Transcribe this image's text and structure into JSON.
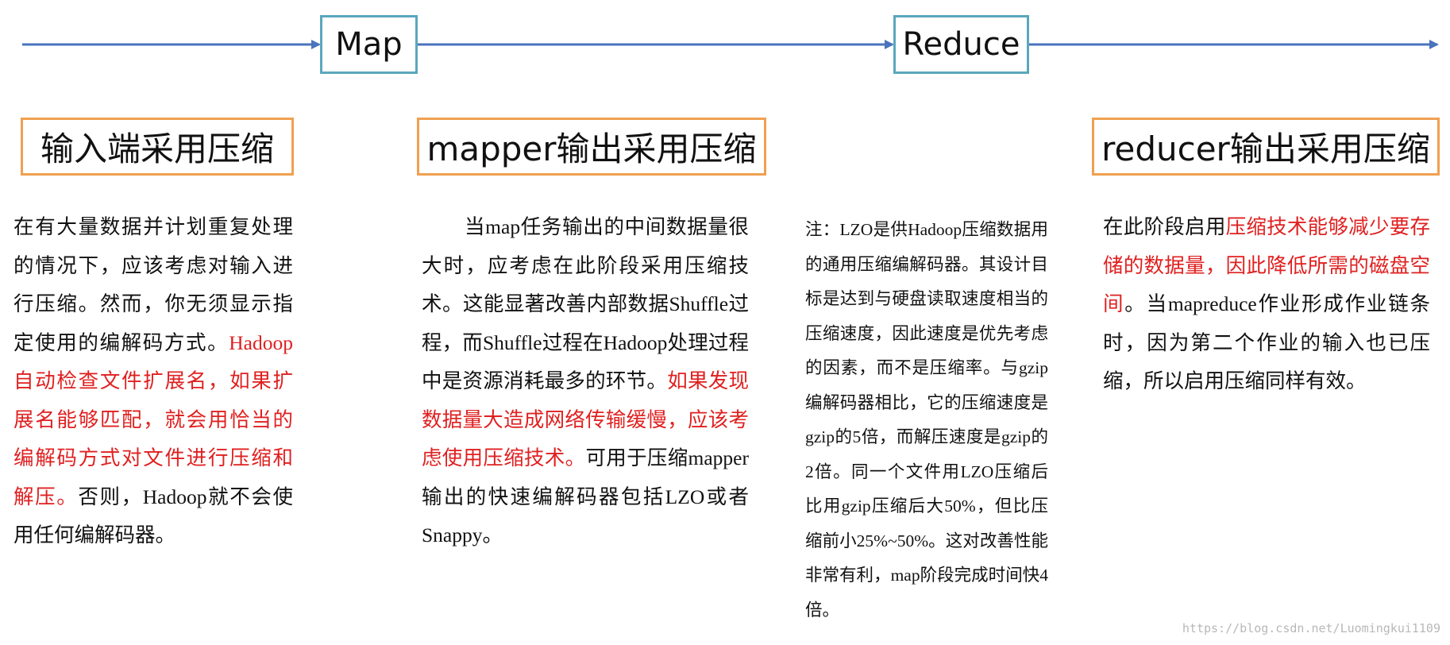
{
  "stages": {
    "map_label": "Map",
    "reduce_label": "Reduce"
  },
  "headings": {
    "input": "输入端采用压缩",
    "mapper": "mapper输出采用压缩",
    "reducer": "reducer输出采用压缩"
  },
  "left_text": {
    "p1": "在有大量数据并计划重复处理的情况下，应该考虑对输入进行压缩。然而，你无须显示指定使用的编解码方式。",
    "red": "Hadoop自动检查文件扩展名，如果扩展名能够匹配，就会用恰当的编解码方式对文件进行压缩和解压。",
    "p2": "否则，Hadoop就不会使用任何编解码器。"
  },
  "center_text": {
    "p1": "当map任务输出的中间数据量很大时，应考虑在此阶段采用压缩技术。这能显著改善内部数据Shuffle过程，而Shuffle过程在Hadoop处理过程中是资源消耗最多的环节。",
    "red": "如果发现数据量大造成网络传输缓慢，应该考虑使用压缩技术。",
    "p2": "可用于压缩mapper输出的快速编解码器包括LZO或者Snappy。"
  },
  "note_text": "注：LZO是供Hadoop压缩数据用的通用压缩编解码器。其设计目标是达到与硬盘读取速度相当的压缩速度，因此速度是优先考虑的因素，而不是压缩率。与gzip编解码器相比，它的压缩速度是gzip的5倍，而解压速度是gzip的2倍。同一个文件用LZO压缩后比用gzip压缩后大50%，但比压缩前小25%~50%。这对改善性能非常有利，map阶段完成时间快4倍。",
  "right_text": {
    "p1": "在此阶段启用",
    "red": "压缩技术能够减少要存储的数据量，因此降低所需的磁盘空间",
    "p2": "。当mapreduce作业形成作业链条时，因为第二个作业的输入也已压缩，所以启用压缩同样有效。"
  },
  "watermark": "https://blog.csdn.net/Luomingkui1109",
  "colors": {
    "arrow": "#4a73bc",
    "stage_border": "#5aa7bd",
    "heading_border": "#f0a050",
    "highlight": "#e02020"
  }
}
